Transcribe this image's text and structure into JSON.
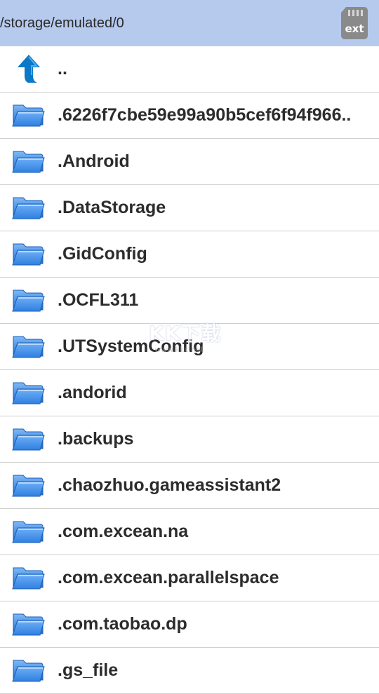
{
  "header": {
    "path": "/storage/emulated/0",
    "ext_label": "ext"
  },
  "rows": [
    {
      "label": "..",
      "icon": "up-arrow-icon"
    },
    {
      "label": ".6226f7cbe59e99a90b5cef6f94f966..",
      "icon": "folder-icon"
    },
    {
      "label": ".Android",
      "icon": "folder-icon"
    },
    {
      "label": ".DataStorage",
      "icon": "folder-icon"
    },
    {
      "label": ".GidConfig",
      "icon": "folder-icon"
    },
    {
      "label": ".OCFL311",
      "icon": "folder-icon"
    },
    {
      "label": ".UTSystemConfig",
      "icon": "folder-icon"
    },
    {
      "label": ".andorid",
      "icon": "folder-icon"
    },
    {
      "label": ".backups",
      "icon": "folder-icon"
    },
    {
      "label": ".chaozhuo.gameassistant2",
      "icon": "folder-icon"
    },
    {
      "label": ".com.excean.na",
      "icon": "folder-icon"
    },
    {
      "label": ".com.excean.parallelspace",
      "icon": "folder-icon"
    },
    {
      "label": ".com.taobao.dp",
      "icon": "folder-icon"
    },
    {
      "label": ".gs_file",
      "icon": "folder-icon"
    }
  ],
  "watermark": {
    "main": "KK下载",
    "sub": "www.kkx.net"
  },
  "colors": {
    "header_bg": "#b6caee",
    "folder_blue": "#2f7fe0",
    "up_arrow": "#0a79c8"
  }
}
